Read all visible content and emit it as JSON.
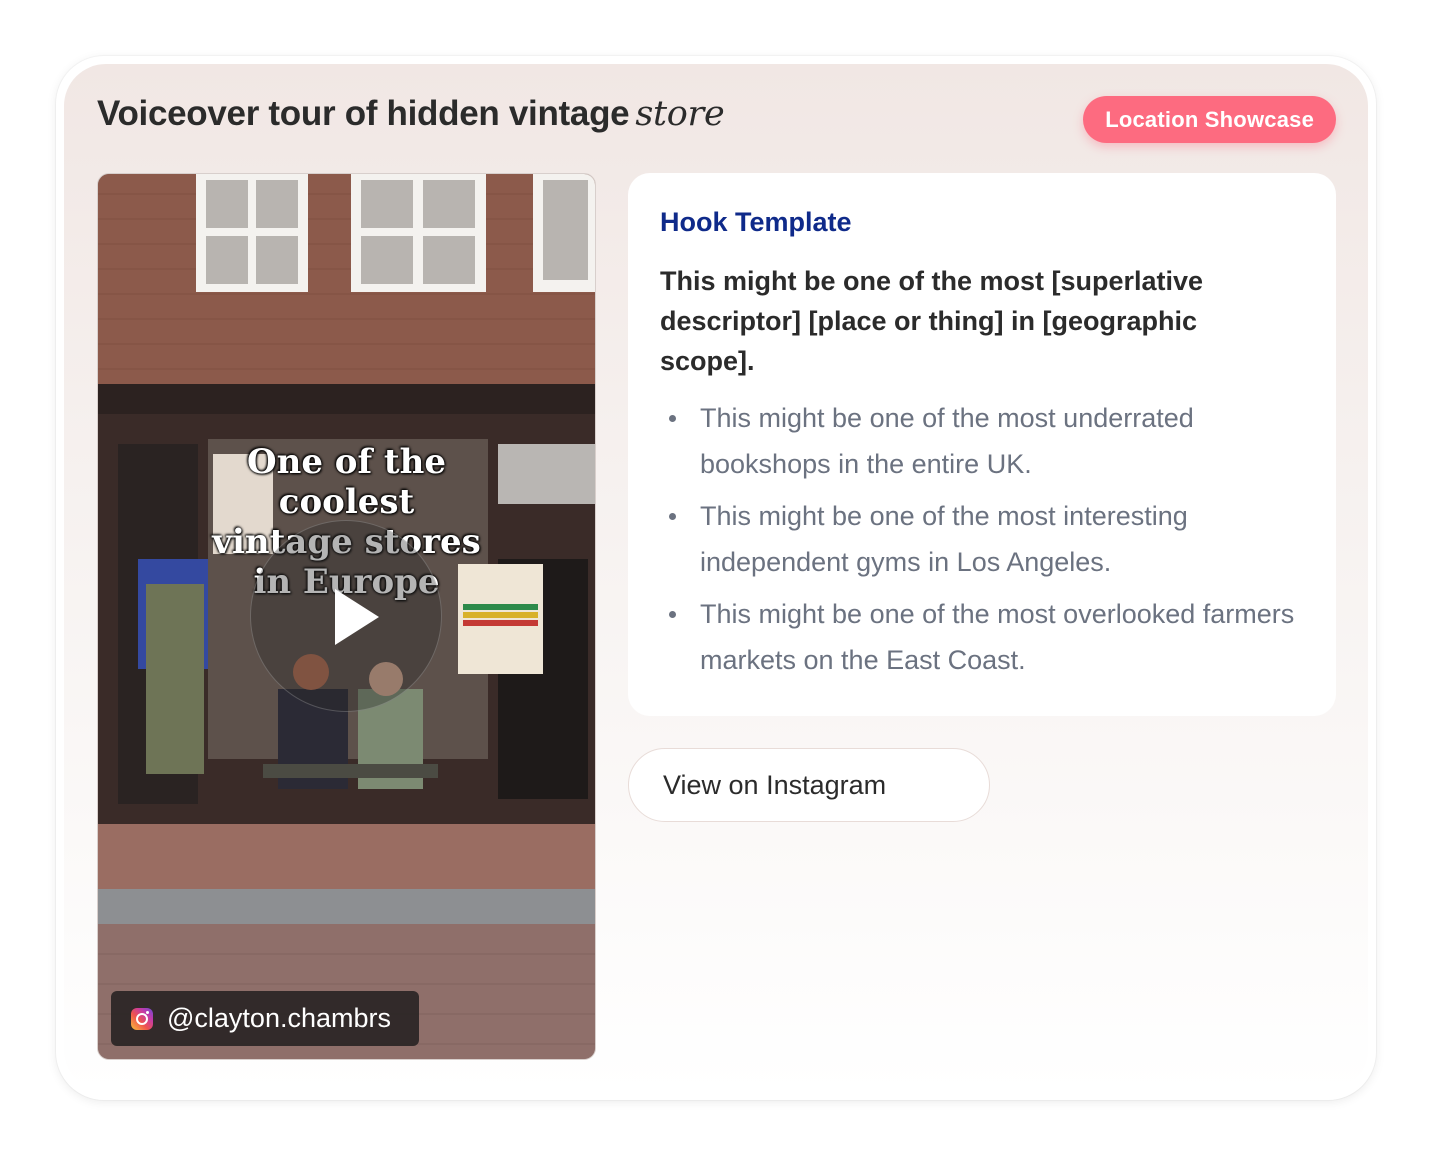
{
  "card": {
    "title_main": "Voiceover tour of hidden vintage",
    "title_serif": "store",
    "badge": "Location Showcase"
  },
  "video": {
    "caption_lines": [
      "One of the",
      "coolest",
      "vintage stores",
      "in Europe"
    ],
    "handle": "@clayton.chambrs",
    "icons": {
      "play": "play-icon",
      "instagram": "instagram-icon"
    }
  },
  "hook": {
    "title": "Hook Template",
    "template": "This might be one of the most [superlative descriptor] [place or thing] in [geographic scope].",
    "examples": [
      "This might be one of the most underrated bookshops in the entire UK.",
      "This might be one of the most interesting independent gyms in Los Angeles.",
      "This might be one of the most overlooked farmers markets on the East Coast."
    ]
  },
  "actions": {
    "view_instagram": "View on Instagram"
  },
  "colors": {
    "badge": "#fd6b80",
    "hook_title": "#0f2a8a",
    "muted_text": "#6b7280"
  }
}
